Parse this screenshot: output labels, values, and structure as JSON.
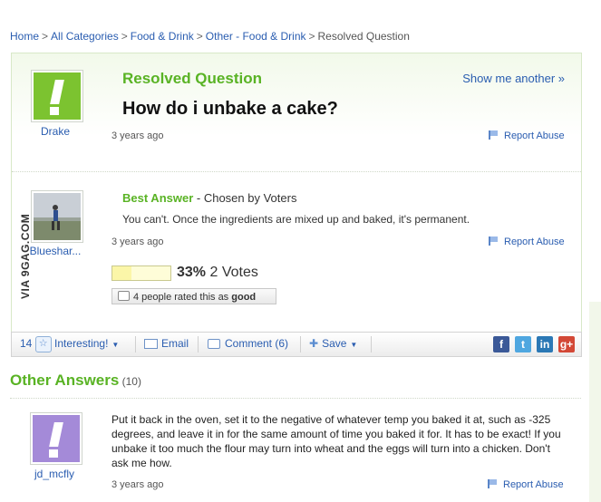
{
  "breadcrumb": {
    "items": [
      "Home",
      "All Categories",
      "Food & Drink",
      "Other - Food & Drink"
    ],
    "current": "Resolved Question",
    "separator": ">"
  },
  "question": {
    "status_title": "Resolved Question",
    "show_another": "Show me another »",
    "asker": "Drake",
    "text": "How do i unbake a cake?",
    "time": "3 years ago",
    "report_abuse": "Report Abuse"
  },
  "best_answer": {
    "label": "Best Answer",
    "chosen_by": " - Chosen by Voters",
    "user": "Blueshar...",
    "text": "You can't. Once the ingredients are mixed up and baked, it's permanent.",
    "time": "3 years ago",
    "report_abuse": "Report Abuse",
    "vote_percent_label": "33%",
    "vote_count": " 2 Votes",
    "vote_fraction": 0.33,
    "rated_prefix": "4 people rated this as ",
    "rated_word": "good"
  },
  "actions": {
    "interesting_count": "14",
    "interesting": "Interesting!",
    "email": "Email",
    "comment": "Comment (6)",
    "save": "Save"
  },
  "social": [
    {
      "icon": "facebook-icon",
      "glyph": "f",
      "color": "#3b5998"
    },
    {
      "icon": "twitter-icon",
      "glyph": "t",
      "color": "#4fa7e0"
    },
    {
      "icon": "linkedin-icon",
      "glyph": "in",
      "color": "#2b78b5"
    },
    {
      "icon": "google-plus-icon",
      "glyph": "g+",
      "color": "#d34836"
    }
  ],
  "other_answers": {
    "title": "Other Answers",
    "count": " (10)",
    "user": "jd_mcfly",
    "text": "Put it back in the oven, set it to the negative of whatever temp you baked it at, such as -325 degrees, and leave it in for the same amount of time you baked it for. It has to be exact! If you unbake it too much the flour may turn into wheat and the eggs will turn into a chicken. Don't ask me how.",
    "time": "3 years ago",
    "report_abuse": "Report Abuse"
  },
  "watermark": "VIA 9GAG.COM",
  "colors": {
    "accent_green": "#59b324",
    "link_blue": "#2a5db0",
    "avatar_green": "#7cc330",
    "avatar_purple": "#a48ad8"
  }
}
